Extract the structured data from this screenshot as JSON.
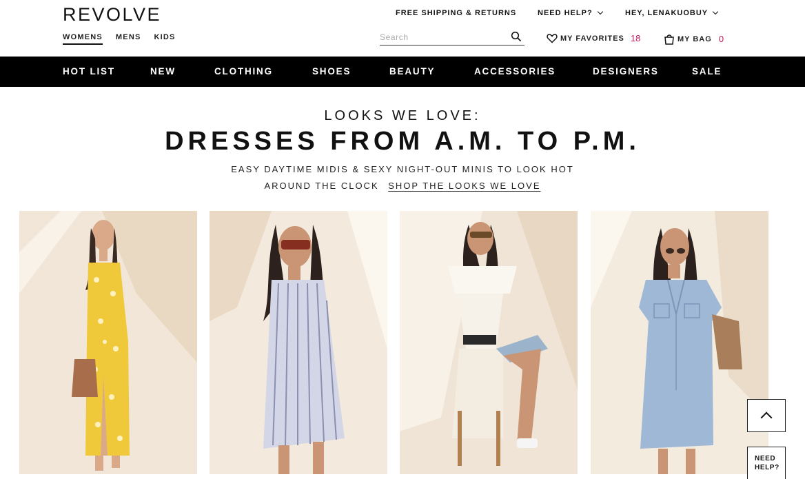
{
  "brand": {
    "logo": "REVOLVE"
  },
  "gender_tabs": [
    {
      "label": "WOMENS",
      "active": true
    },
    {
      "label": "MENS",
      "active": false
    },
    {
      "label": "KIDS",
      "active": false
    }
  ],
  "utility": {
    "shipping": "FREE SHIPPING & RETURNS",
    "help": "NEED HELP?",
    "greeting": "HEY, LENAKUOBUY"
  },
  "search": {
    "placeholder": "Search",
    "value": ""
  },
  "favorites": {
    "label": "MY FAVORITES",
    "count": "18"
  },
  "bag": {
    "label": "MY BAG",
    "count": "0"
  },
  "nav": [
    "HOT LIST",
    "NEW",
    "CLOTHING",
    "SHOES",
    "BEAUTY",
    "ACCESSORIES",
    "DESIGNERS",
    "SALE"
  ],
  "hero": {
    "kicker": "LOOKS WE LOVE:",
    "headline": "DRESSES FROM A.M. TO P.M.",
    "line1": "EASY DAYTIME MIDIS & SEXY NIGHT-OUT MINIS TO LOOK HOT",
    "line2": "AROUND THE CLOCK",
    "link": "SHOP THE LOOKS WE LOVE"
  },
  "tiles": [
    {
      "name": "yellow floral midi dress",
      "dress_color": "#f0c93a"
    },
    {
      "name": "striped mini dress",
      "dress_color": "#c8cce0"
    },
    {
      "name": "white off-shoulder dress",
      "dress_color": "#f6f2ea"
    },
    {
      "name": "chambray shirt dress",
      "dress_color": "#9fb8d6"
    }
  ],
  "floating": {
    "help_line1": "NEED",
    "help_line2": "HELP?"
  },
  "colors": {
    "accent": "#c2185b",
    "nav_bg": "#000000",
    "tile_bg": "#efe3d3"
  }
}
